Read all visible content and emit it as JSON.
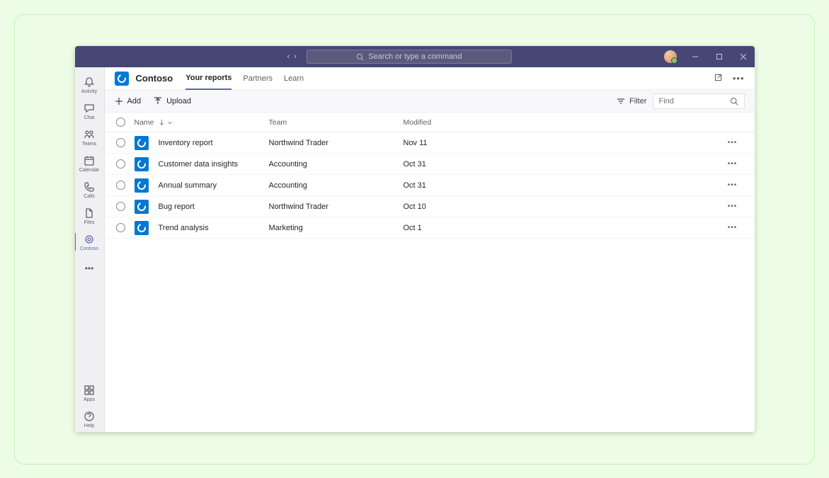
{
  "titlebar": {
    "search_placeholder": "Search or type a command"
  },
  "rail": {
    "items": [
      {
        "label": "Activity"
      },
      {
        "label": "Chat"
      },
      {
        "label": "Teams"
      },
      {
        "label": "Calendar"
      },
      {
        "label": "Calls"
      },
      {
        "label": "Files"
      },
      {
        "label": "Contoso"
      }
    ],
    "bottom": [
      {
        "label": "Apps"
      },
      {
        "label": "Help"
      }
    ]
  },
  "header": {
    "app_name": "Contoso",
    "tabs": [
      {
        "label": "Your reports",
        "active": true
      },
      {
        "label": "Partners"
      },
      {
        "label": "Learn"
      }
    ]
  },
  "toolbar": {
    "add_label": "Add",
    "upload_label": "Upload",
    "filter_label": "Filter",
    "find_placeholder": "Find"
  },
  "table": {
    "columns": {
      "name": "Name",
      "team": "Team",
      "modified": "Modified"
    },
    "rows": [
      {
        "name": "Inventory report",
        "team": "Northwind Trader",
        "modified": "Nov 11"
      },
      {
        "name": "Customer data insights",
        "team": "Accounting",
        "modified": "Oct 31"
      },
      {
        "name": "Annual summary",
        "team": "Accounting",
        "modified": "Oct 31"
      },
      {
        "name": "Bug report",
        "team": "Northwind Trader",
        "modified": "Oct 10"
      },
      {
        "name": "Trend analysis",
        "team": "Marketing",
        "modified": "Oct 1"
      }
    ]
  }
}
